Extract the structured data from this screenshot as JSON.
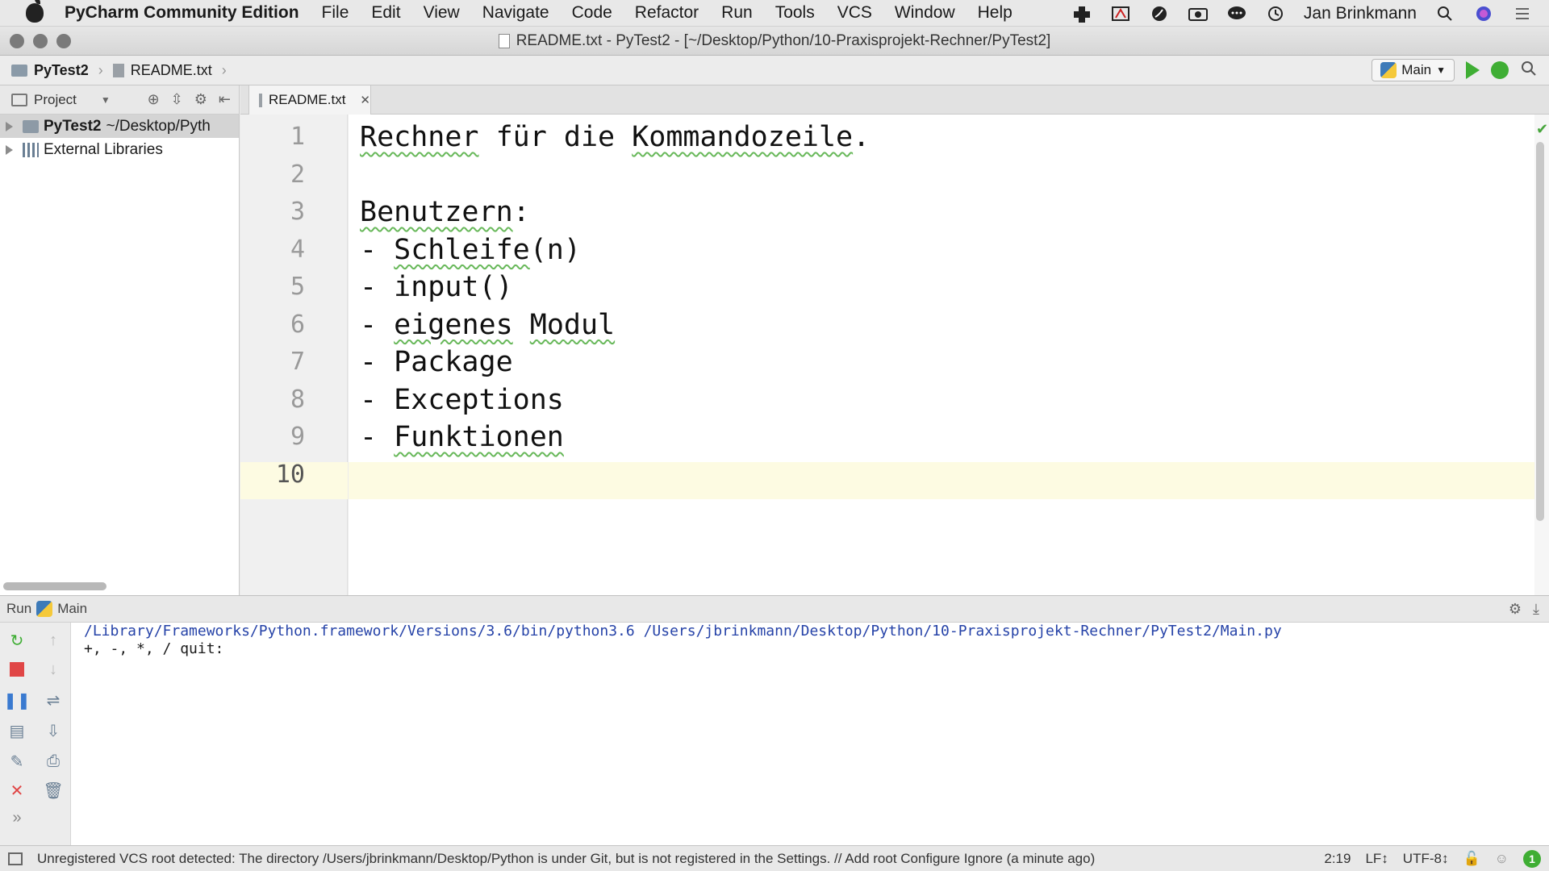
{
  "menubar": {
    "app_name": "PyCharm Community Edition",
    "items": [
      "File",
      "Edit",
      "View",
      "Navigate",
      "Code",
      "Refactor",
      "Run",
      "Tools",
      "VCS",
      "Window",
      "Help"
    ],
    "user": "Jan Brinkmann"
  },
  "window": {
    "title": "README.txt - PyTest2 - [~/Desktop/Python/10-Praxisprojekt-Rechner/PyTest2]"
  },
  "navbar": {
    "project": "PyTest2",
    "file": "README.txt",
    "run_config": "Main"
  },
  "project_panel": {
    "label": "Project",
    "tree": [
      {
        "name": "PyTest2",
        "path": "~/Desktop/Pyth"
      },
      {
        "name": "External Libraries",
        "path": ""
      }
    ]
  },
  "editor": {
    "tab": "README.txt",
    "current_line": 10,
    "lines": [
      "Rechner für die Kommandozeile.",
      "",
      "Benutzern:",
      "- Schleife(n)",
      "- input()",
      "- eigenes Modul",
      "- Package",
      "- Exceptions",
      "- Funktionen",
      ""
    ]
  },
  "run_panel": {
    "label": "Run",
    "config": "Main",
    "console": [
      "/Library/Frameworks/Python.framework/Versions/3.6/bin/python3.6 /Users/jbrinkmann/Desktop/Python/10-Praxisprojekt-Rechner/PyTest2/Main.py",
      "+, -, *, / quit:"
    ]
  },
  "statusbar": {
    "message": "Unregistered VCS root detected: The directory /Users/jbrinkmann/Desktop/Python is under Git, but is not registered in the Settings. // Add root  Configure  Ignore (a minute ago)",
    "position": "2:19",
    "line_sep": "LF↕",
    "encoding": "UTF-8↕",
    "notifications": "1"
  },
  "colors": {
    "run_green": "#3fae34",
    "stop_red": "#e04646",
    "current_line": "#fdfbe2",
    "spell_squiggle": "#68b85a"
  }
}
